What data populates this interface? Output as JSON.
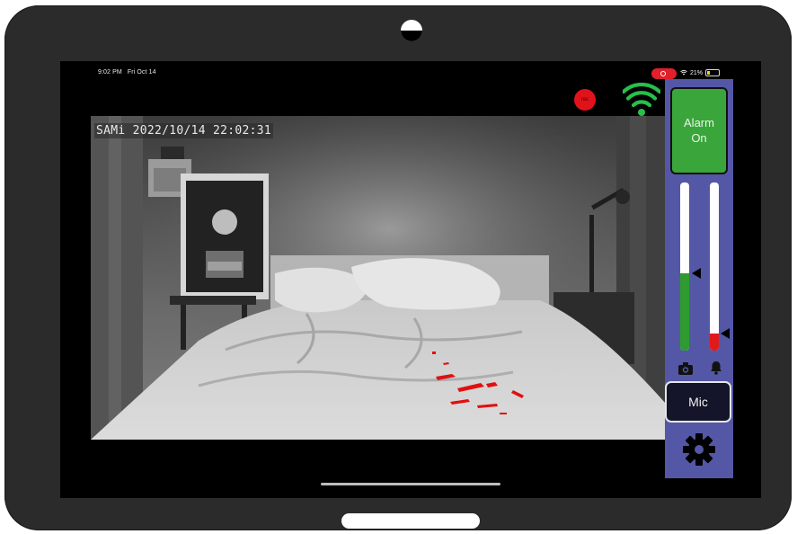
{
  "status_bar": {
    "time": "9:02 PM",
    "date": "Fri Oct 14",
    "battery_percent": "21%",
    "battery_level": 0.21
  },
  "video": {
    "timestamp": "SAMi 2022/10/14 22:02:31"
  },
  "controls": {
    "rec_label": "rec",
    "alarm_line1": "Alarm",
    "alarm_line2": "On",
    "mic_label": "Mic",
    "camera_level": 0.46,
    "alarm_level": 0.1
  },
  "colors": {
    "sidebar": "#5457a6",
    "alarm_button": "#3aa53b",
    "motion_overlay": "#e01010",
    "rec": "#e1121a",
    "wifi": "#26c04a"
  },
  "icons": {
    "camera": "camera-icon",
    "bell": "bell-icon",
    "gear": "gear-icon",
    "wifi": "wifi-icon"
  }
}
